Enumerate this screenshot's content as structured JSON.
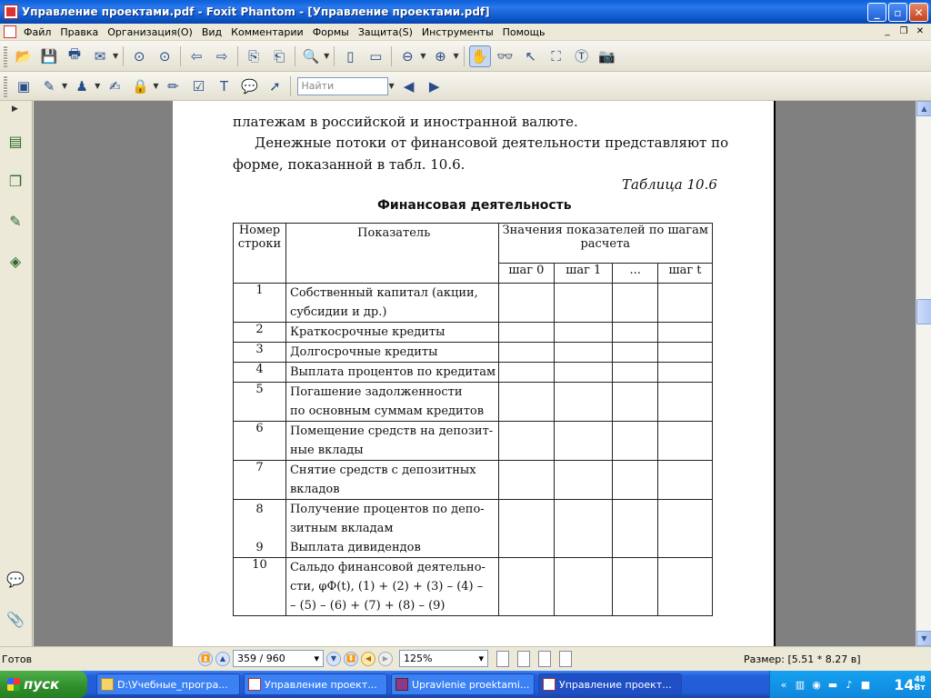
{
  "window": {
    "title": "Управление проектами.pdf - Foxit Phantom - [Управление проектами.pdf]",
    "min": "_",
    "max": "▫",
    "close": "✕"
  },
  "menu": [
    "Файл",
    "Правка",
    "Организация(O)",
    "Вид",
    "Комментарии",
    "Формы",
    "Защита(S)",
    "Инструменты",
    "Помощь"
  ],
  "mdi": {
    "min": "_",
    "restore": "❐",
    "close": "✕"
  },
  "toolbar2": {
    "find_placeholder": "Найти"
  },
  "document": {
    "line1": "платежам в российской и иностранной валюте.",
    "para2_line1": "Денежные потоки от финансовой деятельности представляют по",
    "para2_line2": "форме, показанной в табл. 10.6.",
    "table_label": "Таблица 10.6",
    "table_title": "Финансовая деятельность",
    "headers": {
      "num": [
        "Номер",
        "строки"
      ],
      "indicator": "Показатель",
      "values": [
        "Значения показателей по шагам",
        "расчета"
      ],
      "steps": [
        "шаг 0",
        "шаг 1",
        "...",
        "шаг t"
      ]
    },
    "rows": [
      {
        "num": "1",
        "text": [
          "Собственный капитал (акции,",
          "субсидии и др.)"
        ]
      },
      {
        "num": "2",
        "text": [
          "Краткосрочные кредиты"
        ]
      },
      {
        "num": "3",
        "text": [
          "Долгосрочные кредиты"
        ]
      },
      {
        "num": "4",
        "text": [
          "Выплата процентов по кредитам"
        ]
      },
      {
        "num": "5",
        "text": [
          "Погашение задолженности",
          "по основным суммам кредитов"
        ]
      },
      {
        "num": "6",
        "text": [
          "Помещение средств на депозит-",
          "ные вклады"
        ]
      },
      {
        "num": "7",
        "text": [
          "Снятие средств с депозитных",
          "вкладов"
        ]
      },
      {
        "num": "8",
        "num2": "9",
        "text": [
          "Получение процентов по депо-",
          "зитным вкладам",
          "Выплата дивидендов"
        ]
      },
      {
        "num": "10",
        "text": [
          "Сальдо финансовой деятельно-",
          "сти, φФ(t), (1) + (2) + (3) – (4) –",
          "– (5) – (6) + (7) + (8) – (9)"
        ]
      }
    ]
  },
  "statusbar": {
    "ready": "Готов",
    "page": "359 / 960",
    "zoom": "125%",
    "size": "Размер: [5.51 * 8.27 в]"
  },
  "taskbar": {
    "start": "пуск",
    "tasks": [
      "D:\\Учебные_програ...",
      "Управление проект...",
      "Upravlenie proektami...",
      "Управление проект..."
    ],
    "clock_h": "14",
    "clock_m": "48",
    "clock_day": "Вт"
  }
}
